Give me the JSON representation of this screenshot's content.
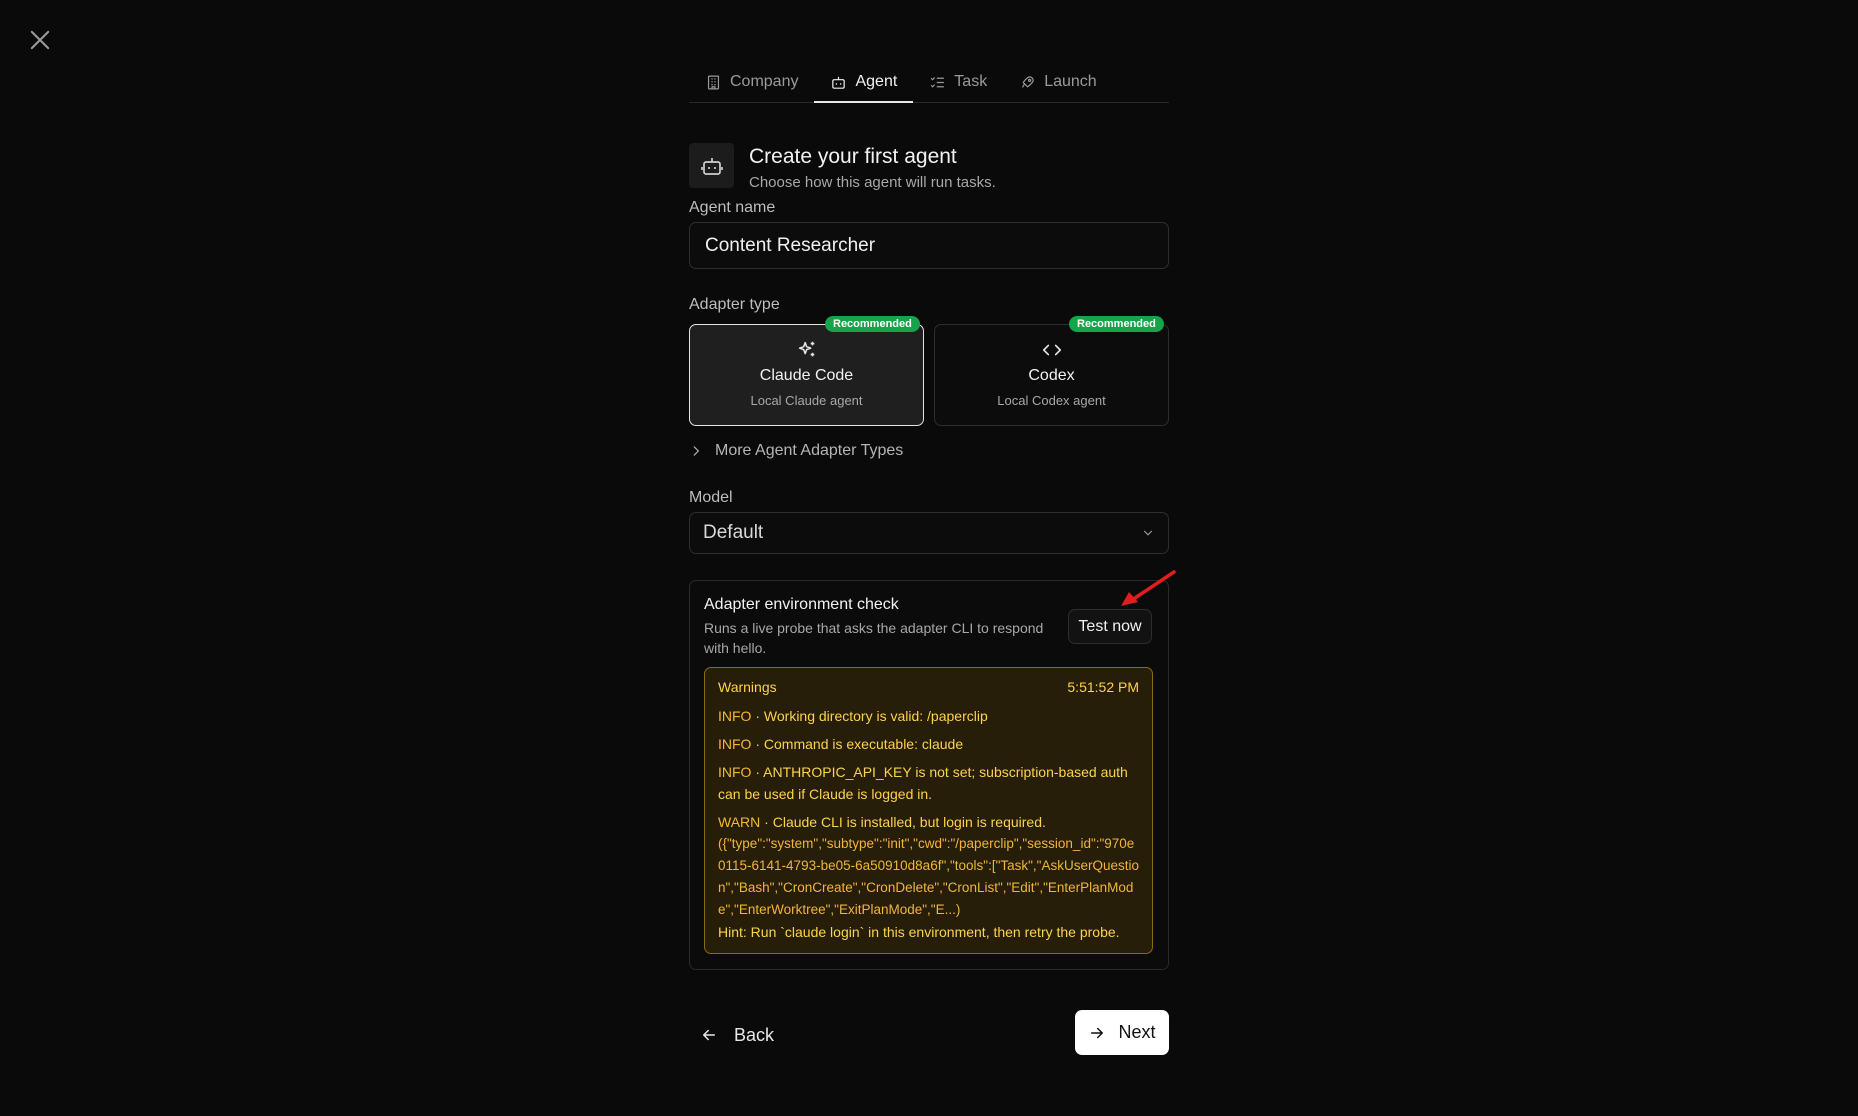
{
  "tabs": [
    {
      "label": "Company",
      "icon": "building-icon"
    },
    {
      "label": "Agent",
      "icon": "bot-icon",
      "active": true
    },
    {
      "label": "Task",
      "icon": "list-checks-icon"
    },
    {
      "label": "Launch",
      "icon": "rocket-icon"
    }
  ],
  "header": {
    "icon": "bot-icon",
    "title": "Create your first agent",
    "subtitle": "Choose how this agent will run tasks."
  },
  "agent_name": {
    "label": "Agent name",
    "value": "Content Researcher"
  },
  "adapter": {
    "label": "Adapter type",
    "options": [
      {
        "title": "Claude Code",
        "subtitle": "Local Claude agent",
        "badge": "Recommended",
        "icon": "sparkles-icon",
        "selected": true
      },
      {
        "title": "Codex",
        "subtitle": "Local Codex agent",
        "badge": "Recommended",
        "icon": "code-icon",
        "selected": false
      }
    ],
    "more_label": "More Agent Adapter Types"
  },
  "model": {
    "label": "Model",
    "value": "Default"
  },
  "env_check": {
    "title": "Adapter environment check",
    "description": "Runs a live probe that asks the adapter CLI to respond with hello.",
    "test_button": "Test now",
    "panel": {
      "heading": "Warnings",
      "time": "5:51:52 PM",
      "entries": [
        {
          "level": "INFO",
          "message": "Working directory is valid: /paperclip"
        },
        {
          "level": "INFO",
          "message": "Command is executable: claude"
        },
        {
          "level": "INFO",
          "message": "ANTHROPIC_API_KEY is not set; subscription-based auth can be used if Claude is logged in."
        },
        {
          "level": "WARN",
          "message": "Claude CLI is installed, but login is required."
        }
      ],
      "detail": "({\"type\":\"system\",\"subtype\":\"init\",\"cwd\":\"/paperclip\",\"session_id\":\"970e0115-6141-4793-be05-6a50910d8a6f\",\"tools\":[\"Task\",\"AskUserQuestion\",\"Bash\",\"CronCreate\",\"CronDelete\",\"CronList\",\"Edit\",\"EnterPlanMode\",\"EnterWorktree\",\"ExitPlanMode\",\"E...)",
      "hint": "Hint: Run `claude login` in this environment, then retry the probe."
    }
  },
  "footer": {
    "back_label": "Back",
    "next_label": "Next"
  },
  "colors": {
    "background": "#0a0a0a",
    "badge_green": "#16a34a",
    "warning_text": "#fcd34d",
    "warning_bg": "#271e09",
    "warning_border": "#8a6a14",
    "annotation_arrow": "#e11d1d"
  }
}
